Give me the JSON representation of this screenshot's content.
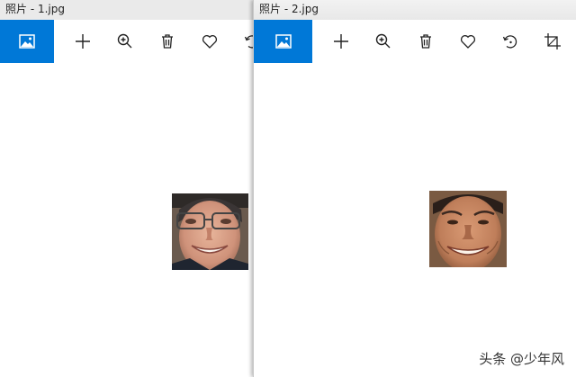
{
  "windows": [
    {
      "title": "照片 - 1.jpg",
      "toolbar": [
        "add-icon",
        "zoom-icon",
        "delete-icon",
        "heart-icon",
        "rotate-icon"
      ]
    },
    {
      "title": "照片 - 2.jpg",
      "toolbar": [
        "add-icon",
        "zoom-icon",
        "delete-icon",
        "heart-icon",
        "rotate-icon",
        "crop-icon"
      ]
    }
  ],
  "accent_color": "#0078d7",
  "watermark": "头条 @少年风"
}
